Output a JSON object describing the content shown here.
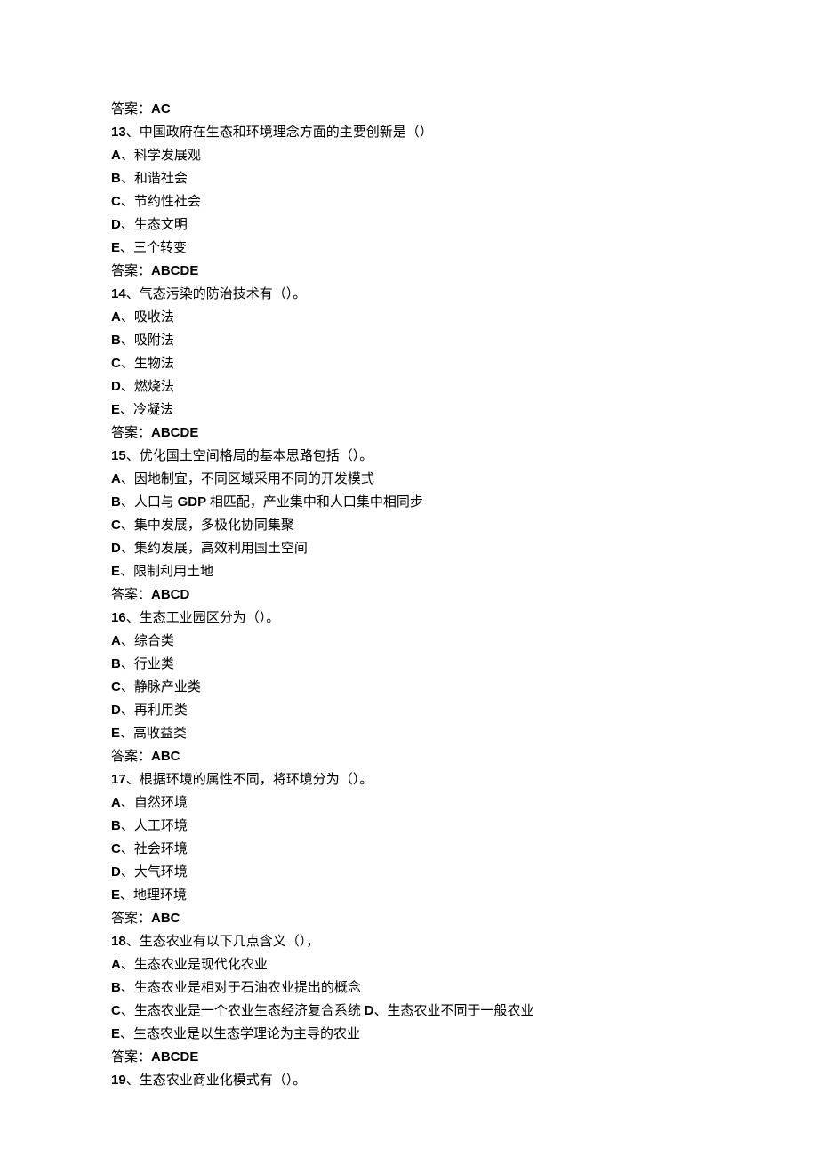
{
  "answer_label": "答案：",
  "pre_answer": "AC",
  "questions": [
    {
      "num": "13",
      "stem": "、中国政府在生态和环境理念方面的主要创新是（）",
      "opts": [
        {
          "l": "A",
          "t": "、科学发展观"
        },
        {
          "l": "B",
          "t": "、和谐社会"
        },
        {
          "l": "C",
          "t": "、节约性社会"
        },
        {
          "l": "D",
          "t": "、生态文明"
        },
        {
          "l": "E",
          "t": "、三个转变"
        }
      ],
      "ans": "ABCDE"
    },
    {
      "num": "14",
      "stem": "、气态污染的防治技术有（）。",
      "opts": [
        {
          "l": "A",
          "t": "、吸收法"
        },
        {
          "l": "B",
          "t": "、吸附法"
        },
        {
          "l": "C",
          "t": "、生物法"
        },
        {
          "l": "D",
          "t": "、燃烧法"
        },
        {
          "l": "E",
          "t": "、冷凝法"
        }
      ],
      "ans": "ABCDE"
    },
    {
      "num": "15",
      "stem": "、优化国土空间格局的基本思路包括（）。",
      "opts": [
        {
          "l": "A",
          "t": "、因地制宜，不同区域采用不同的开发模式"
        },
        {
          "l": "B",
          "pre": "、人口与 ",
          "mid": "GDP",
          "post": " 相匹配，产业集中和人口集中相同步"
        },
        {
          "l": "C",
          "t": "、集中发展，多极化协同集聚"
        },
        {
          "l": "D",
          "t": "、集约发展，高效利用国土空间"
        },
        {
          "l": "E",
          "t": "、限制利用土地"
        }
      ],
      "ans": "ABCD"
    },
    {
      "num": "16",
      "stem": "、生态工业园区分为（）。",
      "opts": [
        {
          "l": "A",
          "t": "、综合类"
        },
        {
          "l": "B",
          "t": "、行业类"
        },
        {
          "l": "C",
          "t": "、静脉产业类"
        },
        {
          "l": "D",
          "t": "、再利用类"
        },
        {
          "l": "E",
          "t": "、高收益类"
        }
      ],
      "ans": "ABC"
    },
    {
      "num": "17",
      "stem": "、根据环境的属性不同，将环境分为（）。",
      "opts": [
        {
          "l": "A",
          "t": "、自然环境"
        },
        {
          "l": "B",
          "t": "、人工环境"
        },
        {
          "l": "C",
          "t": "、社会环境"
        },
        {
          "l": "D",
          "t": "、大气环境"
        },
        {
          "l": "E",
          "t": "、地理环境"
        }
      ],
      "ans": "ABC"
    },
    {
      "num": "18",
      "stem": "、生态农业有以下几点含义（），",
      "opts": [
        {
          "l": "A",
          "t": "、生态农业是现代化农业"
        },
        {
          "l": "B",
          "t": "、生态农业是相对于石油农业提出的概念"
        },
        {
          "l": "C",
          "pre": "、生态农业是一个农业生态经济复合系统 ",
          "mid": "D",
          "post": "、生态农业不同于一般农业"
        },
        {
          "l": "E",
          "t": "、生态农业是以生态学理论为主导的农业"
        }
      ],
      "ans": "ABCDE"
    },
    {
      "num": "19",
      "stem": "、生态农业商业化模式有（）。"
    }
  ]
}
